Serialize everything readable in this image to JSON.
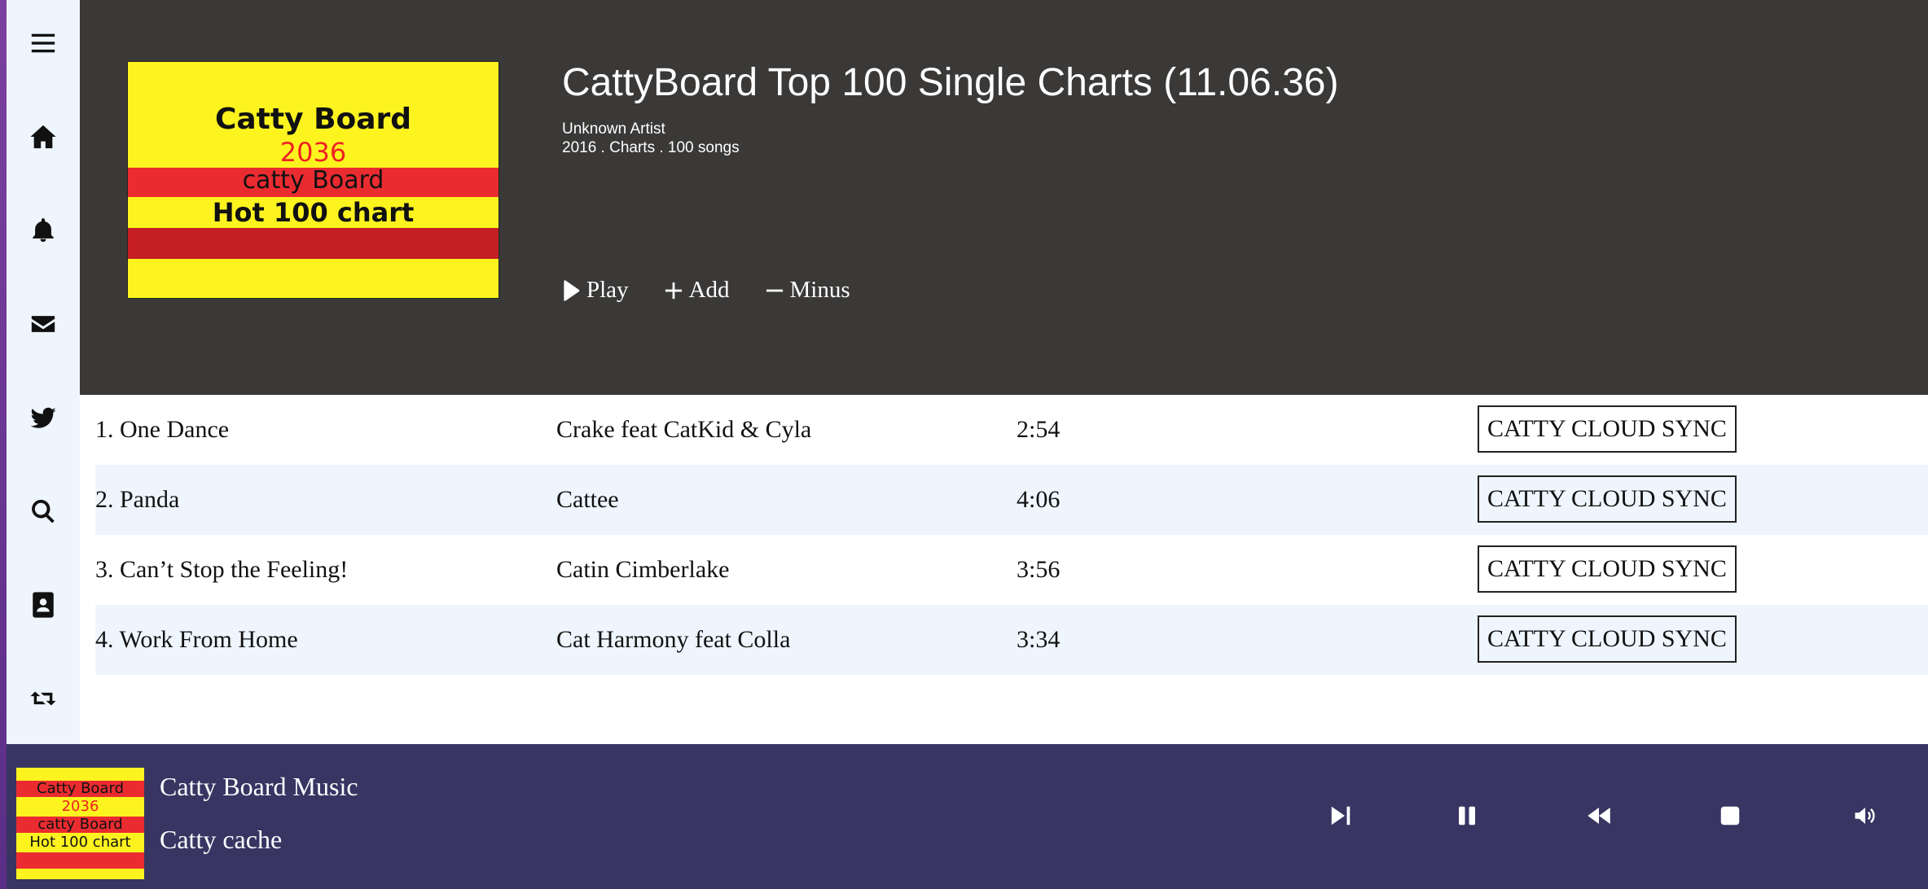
{
  "sidebar": {
    "items": [
      {
        "icon": "menu-icon"
      },
      {
        "icon": "home-icon"
      },
      {
        "icon": "bell-icon"
      },
      {
        "icon": "mail-icon"
      },
      {
        "icon": "twitter-icon"
      },
      {
        "icon": "search-icon"
      },
      {
        "icon": "contact-card-icon"
      },
      {
        "icon": "retweet-icon"
      }
    ]
  },
  "album": {
    "cover_lines": [
      "Catty Board",
      "2036",
      "catty Board",
      "Hot 100 chart"
    ],
    "title": "CattyBoard Top 100 Single Charts (11.06.36)",
    "artist": "Unknown Artist",
    "info": "2016 . Charts . 100 songs",
    "actions": {
      "play": "Play",
      "add": "Add",
      "minus": "Minus"
    }
  },
  "tracks": [
    {
      "name": "1. One Dance",
      "artist": "Crake feat CatKid & Cyla",
      "duration": "2:54",
      "sync": "CATTY CLOUD SYNC"
    },
    {
      "name": "2. Panda",
      "artist": "Cattee",
      "duration": "4:06",
      "sync": "CATTY CLOUD SYNC"
    },
    {
      "name": "3. Can’t Stop the Feeling!",
      "artist": "Catin Cimberlake",
      "duration": "3:56",
      "sync": "CATTY CLOUD SYNC"
    },
    {
      "name": "4. Work From Home",
      "artist": "Cat Harmony feat Colla",
      "duration": "3:34",
      "sync": "CATTY CLOUD SYNC"
    }
  ],
  "player": {
    "cover_lines": [
      "Catty Board",
      "2036",
      "catty Board",
      "Hot 100 chart"
    ],
    "title": "Catty Board Music",
    "subtitle": "Catty cache",
    "controls": [
      "skip-next-icon",
      "pause-icon",
      "rewind-icon",
      "stop-icon",
      "volume-icon"
    ]
  },
  "colors": {
    "hero_bg": "#3a3938",
    "sidebar_bg": "#eef5fd",
    "row_alt_bg": "#eef5fd",
    "player_bg": "#383563",
    "cover_yellow": "#fdf31f",
    "cover_red": "#ea2c31"
  }
}
